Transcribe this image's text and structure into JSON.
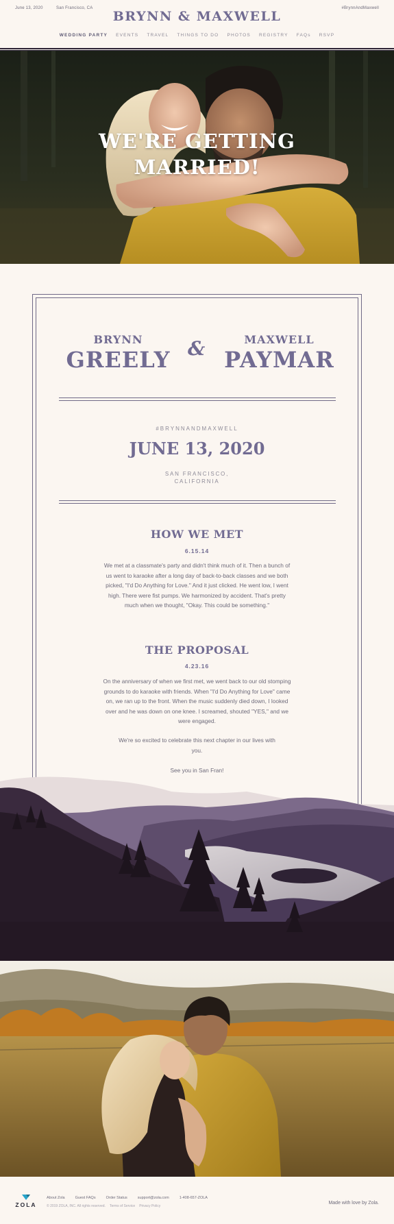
{
  "header": {
    "date": "June 13, 2020",
    "location": "San Francisco, CA",
    "hashtag": "#BrynnAndMaxwell",
    "title": "BRYNN & MAXWELL"
  },
  "nav": {
    "items": [
      "WEDDING PARTY",
      "EVENTS",
      "TRAVEL",
      "THINGS TO DO",
      "PHOTOS",
      "REGISTRY",
      "FAQs",
      "RSVP"
    ],
    "active": "WEDDING PARTY"
  },
  "hero": {
    "title_line1": "WE'RE GETTING",
    "title_line2": "MARRIED!"
  },
  "couple": {
    "bride_first": "BRYNN",
    "bride_last": "GREELY",
    "ampersand": "&",
    "groom_first": "MAXWELL",
    "groom_last": "PAYMAR"
  },
  "event": {
    "hashtag": "#BRYNNANDMAXWELL",
    "date": "JUNE 13, 2020",
    "city": "SAN FRANCISCO,",
    "state": "CALIFORNIA"
  },
  "how_we_met": {
    "title": "HOW WE MET",
    "date": "6.15.14",
    "body": "We met at a classmate's party and didn't think much of it. Then a bunch of us went to karaoke after a long day of back-to-back classes and we both picked, \"I'd Do Anything for Love.\" And it just clicked. He went low, I went high. There were fist pumps. We harmonized by accident. That's pretty much when we thought, \"Okay. This could be something.\""
  },
  "proposal": {
    "title": "THE PROPOSAL",
    "date": "4.23.16",
    "body": "On the anniversary of when we first met, we went back to our old stomping grounds to do karaoke with friends. When \"I'd Do Anything for Love\" came on, we ran up to the front. When the music suddenly died down, I looked over and he was down on one knee. I screamed, shouted \"YES,\" and we were engaged.",
    "excited": "We're so excited to celebrate this next chapter in our lives with you.",
    "closing": "See you in San Fran!"
  },
  "footer": {
    "brand": "ZOLA",
    "links": [
      "About Zola",
      "Guest FAQs",
      "Order Status",
      "support@zola.com",
      "1-408-657-ZOLA"
    ],
    "legal": [
      "© 2019 ZOLA, INC. All rights reserved.",
      "Terms of Service",
      "Privacy Policy"
    ],
    "made_with": "Made with love by Zola."
  },
  "colors": {
    "background": "#fbf6f1",
    "accent": "#716b92",
    "text": "#6d6a7a",
    "dark": "#2d2436"
  }
}
